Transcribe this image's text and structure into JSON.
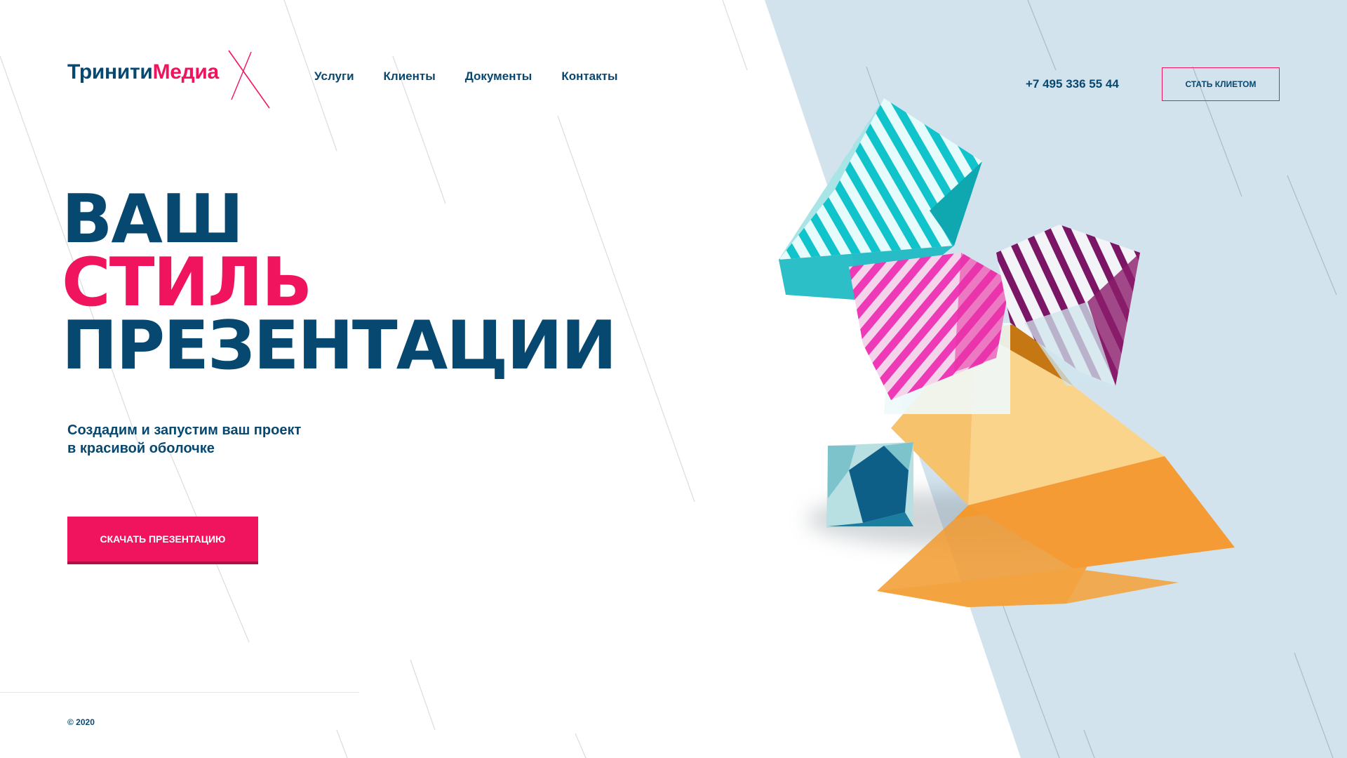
{
  "header": {
    "logo": {
      "part1": "Тринити",
      "part2": "Медиа"
    },
    "nav": [
      {
        "label": "Услуги"
      },
      {
        "label": "Клиенты"
      },
      {
        "label": "Документы"
      },
      {
        "label": "Контакты"
      }
    ],
    "phone": "+7 495 336 55 44",
    "cta_label": "СТАТЬ КЛИЕТОМ"
  },
  "hero": {
    "line1": "ВАШ",
    "line2": "СТИЛЬ",
    "line3": "ПРЕЗЕНТАЦИИ",
    "subtitle_line1": "Создадим и запустим ваш проект",
    "subtitle_line2": "в красивой оболочке",
    "download_label": "СКАЧАТЬ ПРЕЗЕНТАЦИЮ"
  },
  "footer": {
    "copyright": "© 2020"
  },
  "colors": {
    "brand_dark": "#074871",
    "brand_pink": "#f0145f",
    "panel_bg": "#d3e3ee"
  },
  "icons": [
    "logo-cross-mark"
  ]
}
